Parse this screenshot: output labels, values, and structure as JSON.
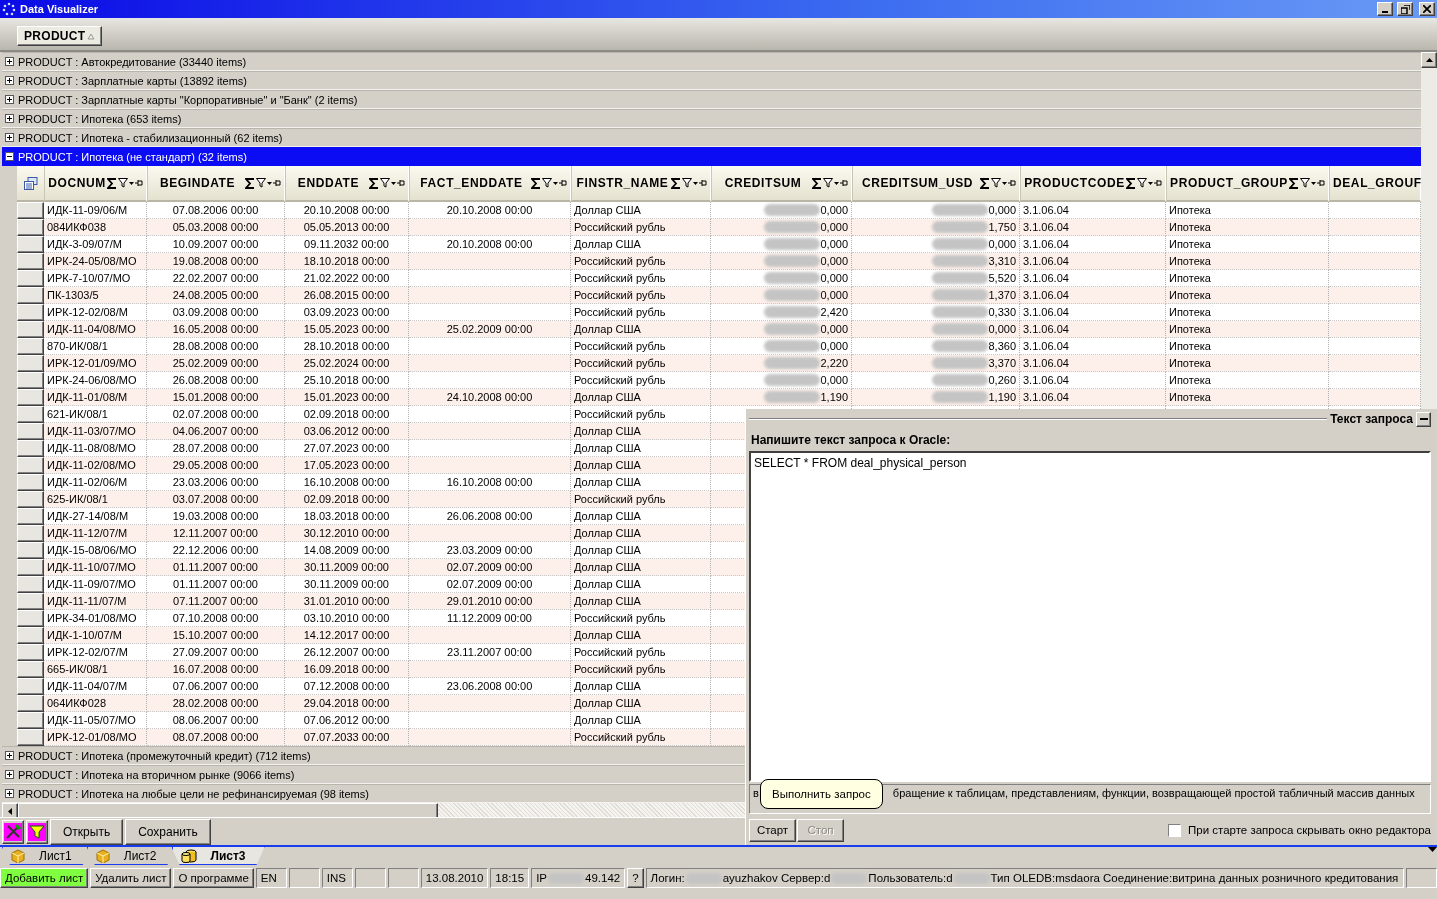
{
  "window": {
    "title": "Data Visualizer"
  },
  "group_by": [
    {
      "label": "PRODUCT"
    }
  ],
  "groups": [
    {
      "label": "PRODUCT : Автокредитование (33440 items)",
      "expanded": false,
      "selected": false
    },
    {
      "label": "PRODUCT :  Зарплатные карты (13892 items)",
      "expanded": false,
      "selected": false
    },
    {
      "label": "PRODUCT : Зарплатные карты \"Корпоративные\" и \"Банк\" (2 items)",
      "expanded": false,
      "selected": false
    },
    {
      "label": "PRODUCT : Ипотека (653 items)",
      "expanded": false,
      "selected": false
    },
    {
      "label": "PRODUCT : Ипотека - стабилизационный (62 items)",
      "expanded": false,
      "selected": false
    },
    {
      "label": "PRODUCT : Ипотека (не стандарт) (32 items)",
      "expanded": true,
      "selected": true,
      "table": {
        "columns": [
          {
            "label": "DOCNUM",
            "kind": "text"
          },
          {
            "label": "BEGINDATE",
            "kind": "date"
          },
          {
            "label": "ENDDATE",
            "kind": "date"
          },
          {
            "label": "FACT_ENDDATE",
            "kind": "date"
          },
          {
            "label": "FINSTR_NAME",
            "kind": "text"
          },
          {
            "label": "CREDITSUM",
            "kind": "masked_money"
          },
          {
            "label": "CREDITSUM_USD",
            "kind": "masked_money"
          },
          {
            "label": "PRODUCTCODE",
            "kind": "text"
          },
          {
            "label": "PRODUCT_GROUP",
            "kind": "text"
          },
          {
            "label": "DEAL_GROUF",
            "kind": "text"
          }
        ],
        "rows": [
          {
            "cells": [
              "ИДК-11-09/06/М",
              "07.08.2006 00:00",
              "20.10.2008 00:00",
              "20.10.2008 00:00",
              "Доллар США",
              "0,000",
              "0,000",
              "3.1.06.04",
              "Ипотека",
              null
            ]
          },
          {
            "cells": [
              "084ИКФ038",
              "05.03.2008 00:00",
              "05.05.2013 00:00",
              null,
              "Российский рубль",
              "0,000",
              "1,750",
              "3.1.06.04",
              "Ипотека",
              null
            ]
          },
          {
            "cells": [
              "ИДК-3-09/07/М",
              "10.09.2007 00:00",
              "09.11.2032 00:00",
              "20.10.2008 00:00",
              "Доллар США",
              "0,000",
              "0,000",
              "3.1.06.04",
              "Ипотека",
              null
            ]
          },
          {
            "cells": [
              "ИРК-24-05/08/МО",
              "19.08.2008 00:00",
              "18.10.2018 00:00",
              null,
              "Российский рубль",
              "0,000",
              "3,310",
              "3.1.06.04",
              "Ипотека",
              null
            ]
          },
          {
            "cells": [
              "ИРК-7-10/07/МО",
              "22.02.2007 00:00",
              "21.02.2022 00:00",
              null,
              "Российский рубль",
              "0,000",
              "5,520",
              "3.1.06.04",
              "Ипотека",
              null
            ]
          },
          {
            "cells": [
              "ПК-1303/5",
              "24.08.2005 00:00",
              "26.08.2015 00:00",
              null,
              "Российский рубль",
              "0,000",
              "1,370",
              "3.1.06.04",
              "Ипотека",
              null
            ]
          },
          {
            "cells": [
              "ИРК-12-02/08/М",
              "03.09.2008 00:00",
              "03.09.2023 00:00",
              null,
              "Российский рубль",
              "2,420",
              "0,330",
              "3.1.06.04",
              "Ипотека",
              null
            ]
          },
          {
            "cells": [
              "ИДК-11-04/08/МО",
              "16.05.2008 00:00",
              "15.05.2023 00:00",
              "25.02.2009 00:00",
              "Доллар США",
              "0,000",
              "0,000",
              "3.1.06.04",
              "Ипотека",
              null
            ]
          },
          {
            "cells": [
              "870-ИК/08/1",
              "28.08.2008 00:00",
              "28.10.2018 00:00",
              null,
              "Российский рубль",
              "0,000",
              "8,360",
              "3.1.06.04",
              "Ипотека",
              null
            ]
          },
          {
            "cells": [
              "ИРК-12-01/09/МО",
              "25.02.2009 00:00",
              "25.02.2024 00:00",
              null,
              "Российский рубль",
              "2,220",
              "3,370",
              "3.1.06.04",
              "Ипотека",
              null
            ]
          },
          {
            "cells": [
              "ИРК-24-06/08/МО",
              "26.08.2008 00:00",
              "25.10.2018 00:00",
              null,
              "Российский рубль",
              "0,000",
              "0,260",
              "3.1.06.04",
              "Ипотека",
              null
            ]
          },
          {
            "cells": [
              "ИДК-11-01/08/М",
              "15.01.2008 00:00",
              "15.01.2023 00:00",
              "24.10.2008 00:00",
              "Доллар США",
              "1,190",
              "1,190",
              "3.1.06.04",
              "Ипотека",
              null
            ]
          },
          {
            "cells": [
              "621-ИК/08/1",
              "02.07.2008 00:00",
              "02.09.2018 00:00",
              null,
              "Российский рубль"
            ]
          },
          {
            "cells": [
              "ИДК-11-03/07/МО",
              "04.06.2007 00:00",
              "03.06.2012 00:00",
              null,
              "Доллар США"
            ]
          },
          {
            "cells": [
              "ИДК-11-08/08/МО",
              "28.07.2008 00:00",
              "27.07.2023 00:00",
              null,
              "Доллар США"
            ]
          },
          {
            "cells": [
              "ИДК-11-02/08/МО",
              "29.05.2008 00:00",
              "17.05.2023 00:00",
              null,
              "Доллар США"
            ]
          },
          {
            "cells": [
              "ИДК-11-02/06/М",
              "23.03.2006 00:00",
              "16.10.2008 00:00",
              "16.10.2008 00:00",
              "Доллар США"
            ]
          },
          {
            "cells": [
              "625-ИК/08/1",
              "03.07.2008 00:00",
              "02.09.2018 00:00",
              null,
              "Российский рубль"
            ]
          },
          {
            "cells": [
              "ИДК-27-14/08/М",
              "19.03.2008 00:00",
              "18.03.2018 00:00",
              "26.06.2008 00:00",
              "Доллар США"
            ]
          },
          {
            "cells": [
              "ИДК-11-12/07/М",
              "12.11.2007 00:00",
              "30.12.2010 00:00",
              null,
              "Доллар США"
            ]
          },
          {
            "cells": [
              "ИДК-15-08/06/МО",
              "22.12.2006 00:00",
              "14.08.2009 00:00",
              "23.03.2009 00:00",
              "Доллар США"
            ]
          },
          {
            "cells": [
              "ИДК-11-10/07/МО",
              "01.11.2007 00:00",
              "30.11.2009 00:00",
              "02.07.2009 00:00",
              "Доллар США"
            ]
          },
          {
            "cells": [
              "ИДК-11-09/07/МО",
              "01.11.2007 00:00",
              "30.11.2009 00:00",
              "02.07.2009 00:00",
              "Доллар США"
            ]
          },
          {
            "cells": [
              "ИДК-11-11/07/М",
              "07.11.2007 00:00",
              "31.01.2010 00:00",
              "29.01.2010 00:00",
              "Доллар США"
            ]
          },
          {
            "cells": [
              "ИРК-34-01/08/МО",
              "07.10.2008 00:00",
              "03.10.2010 00:00",
              "11.12.2009 00:00",
              "Российский рубль"
            ]
          },
          {
            "cells": [
              "ИДК-1-10/07/М",
              "15.10.2007 00:00",
              "14.12.2017 00:00",
              null,
              "Доллар США"
            ]
          },
          {
            "cells": [
              "ИРК-12-02/07/М",
              "27.09.2007 00:00",
              "26.12.2007 00:00",
              "23.11.2007 00:00",
              "Российский рубль"
            ]
          },
          {
            "cells": [
              "665-ИК/08/1",
              "16.07.2008 00:00",
              "16.09.2018 00:00",
              null,
              "Российский рубль"
            ]
          },
          {
            "cells": [
              "ИДК-11-04/07/М",
              "07.06.2007 00:00",
              "07.12.2008 00:00",
              "23.06.2008 00:00",
              "Доллар США"
            ]
          },
          {
            "cells": [
              "064ИКФ028",
              "28.02.2008 00:00",
              "29.04.2018 00:00",
              null,
              "Доллар США"
            ]
          },
          {
            "cells": [
              "ИДК-11-05/07/МО",
              "08.06.2007 00:00",
              "07.06.2012 00:00",
              null,
              "Доллар США"
            ]
          },
          {
            "cells": [
              "ИРК-12-01/08/МО",
              "08.07.2008 00:00",
              "07.07.2033 00:00",
              null,
              "Российский рубль"
            ]
          }
        ]
      }
    },
    {
      "label": "PRODUCT : Ипотека (промежуточный кредит) (712 items)",
      "expanded": false,
      "selected": false
    },
    {
      "label": "PRODUCT : Ипотека на вторичном рынке (9066 items)",
      "expanded": false,
      "selected": false
    },
    {
      "label": "PRODUCT : Ипотека на любые цели не рефинансируемая (98 items)",
      "expanded": false,
      "selected": false
    }
  ],
  "query_panel": {
    "title": "Текст запроса",
    "prompt": "Напишите текст запроса к Oracle:",
    "query": "SELECT * FROM deal_physical_person",
    "hint_parts": [
      "в",
      "бращение к таблицам, представлениям, функции, возвращающей простой табличный массив данных"
    ],
    "tooltip": "Выполнить запрос",
    "buttons": [
      {
        "label": "Старт",
        "disabled": false
      },
      {
        "label": "Стоп",
        "disabled": true
      }
    ],
    "hide_option": {
      "label": "При старте запроса скрывать окно редактора",
      "checked": false
    }
  },
  "toolbar": {
    "buttons": [
      "Открыть",
      "Сохранить"
    ]
  },
  "sheets": [
    {
      "label": "Лист1",
      "selected": false
    },
    {
      "label": "Лист2",
      "selected": false
    },
    {
      "label": "Лист3",
      "selected": true
    }
  ],
  "status_bar": [
    {
      "kind": "button",
      "label": "Добавить лист",
      "highlighted": true
    },
    {
      "kind": "button",
      "label": "Удалить лист",
      "highlighted": false
    },
    {
      "kind": "button",
      "label": "О программе",
      "highlighted": false
    },
    {
      "kind": "panel",
      "segments": [
        "EN"
      ]
    },
    {
      "kind": "panel"
    },
    {
      "kind": "panel",
      "segments": [
        "INS"
      ]
    },
    {
      "kind": "panel"
    },
    {
      "kind": "panel"
    },
    {
      "kind": "panel",
      "segments": [
        "13.08.2010"
      ]
    },
    {
      "kind": "panel",
      "segments": [
        "18:15"
      ]
    },
    {
      "kind": "panel",
      "segments": [
        "IP",
        "49.142"
      ]
    },
    {
      "kind": "button",
      "label": "?",
      "highlighted": false
    },
    {
      "kind": "info_panel",
      "segments": [
        "Логин:",
        "ayuzhakov  Сервер:d",
        "Пользователь:d",
        "Тип OLEDB:msdaora   Соединение:витрина данных розничного кредитования"
      ]
    },
    {
      "kind": "panel"
    }
  ]
}
